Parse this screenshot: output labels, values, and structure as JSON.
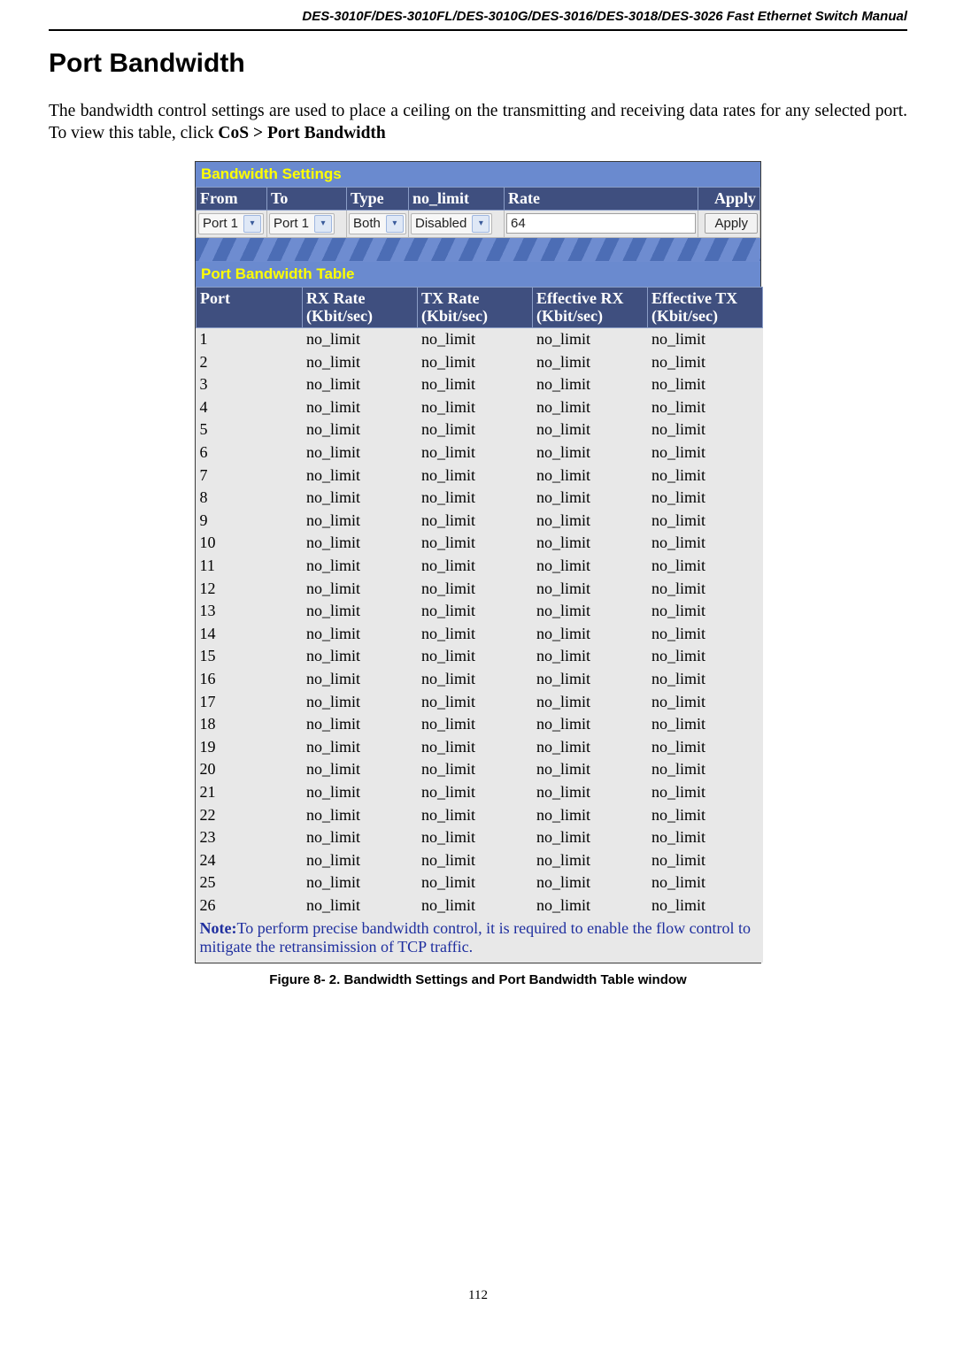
{
  "doc_header": "DES-3010F/DES-3010FL/DES-3010G/DES-3016/DES-3018/DES-3026 Fast Ethernet Switch Manual",
  "title": "Port Bandwidth",
  "intro_plain_before": "The bandwidth control settings are used to place a ceiling on the transmitting and receiving data rates for any selected port. To view this table, click ",
  "intro_bold": "CoS > Port Bandwidth",
  "settings": {
    "header": "Bandwidth Settings",
    "columns": {
      "from": "From",
      "to": "To",
      "type": "Type",
      "no_limit": "no_limit",
      "rate": "Rate",
      "apply_header": "Apply"
    },
    "values": {
      "from": "Port 1",
      "to": "Port 1",
      "type": "Both",
      "no_limit": "Disabled",
      "rate": "64",
      "apply_button": "Apply"
    }
  },
  "table": {
    "header": "Port Bandwidth Table",
    "columns": {
      "port": "Port",
      "rx": "RX Rate (Kbit/sec)",
      "tx": "TX Rate (Kbit/sec)",
      "erx": "Effective RX (Kbit/sec)",
      "etx": "Effective TX (Kbit/sec)"
    },
    "rows": [
      {
        "port": "1",
        "rx": "no_limit",
        "tx": "no_limit",
        "erx": "no_limit",
        "etx": "no_limit"
      },
      {
        "port": "2",
        "rx": "no_limit",
        "tx": "no_limit",
        "erx": "no_limit",
        "etx": "no_limit"
      },
      {
        "port": "3",
        "rx": "no_limit",
        "tx": "no_limit",
        "erx": "no_limit",
        "etx": "no_limit"
      },
      {
        "port": "4",
        "rx": "no_limit",
        "tx": "no_limit",
        "erx": "no_limit",
        "etx": "no_limit"
      },
      {
        "port": "5",
        "rx": "no_limit",
        "tx": "no_limit",
        "erx": "no_limit",
        "etx": "no_limit"
      },
      {
        "port": "6",
        "rx": "no_limit",
        "tx": "no_limit",
        "erx": "no_limit",
        "etx": "no_limit"
      },
      {
        "port": "7",
        "rx": "no_limit",
        "tx": "no_limit",
        "erx": "no_limit",
        "etx": "no_limit"
      },
      {
        "port": "8",
        "rx": "no_limit",
        "tx": "no_limit",
        "erx": "no_limit",
        "etx": "no_limit"
      },
      {
        "port": "9",
        "rx": "no_limit",
        "tx": "no_limit",
        "erx": "no_limit",
        "etx": "no_limit"
      },
      {
        "port": "10",
        "rx": "no_limit",
        "tx": "no_limit",
        "erx": "no_limit",
        "etx": "no_limit"
      },
      {
        "port": "11",
        "rx": "no_limit",
        "tx": "no_limit",
        "erx": "no_limit",
        "etx": "no_limit"
      },
      {
        "port": "12",
        "rx": "no_limit",
        "tx": "no_limit",
        "erx": "no_limit",
        "etx": "no_limit"
      },
      {
        "port": "13",
        "rx": "no_limit",
        "tx": "no_limit",
        "erx": "no_limit",
        "etx": "no_limit"
      },
      {
        "port": "14",
        "rx": "no_limit",
        "tx": "no_limit",
        "erx": "no_limit",
        "etx": "no_limit"
      },
      {
        "port": "15",
        "rx": "no_limit",
        "tx": "no_limit",
        "erx": "no_limit",
        "etx": "no_limit"
      },
      {
        "port": "16",
        "rx": "no_limit",
        "tx": "no_limit",
        "erx": "no_limit",
        "etx": "no_limit"
      },
      {
        "port": "17",
        "rx": "no_limit",
        "tx": "no_limit",
        "erx": "no_limit",
        "etx": "no_limit"
      },
      {
        "port": "18",
        "rx": "no_limit",
        "tx": "no_limit",
        "erx": "no_limit",
        "etx": "no_limit"
      },
      {
        "port": "19",
        "rx": "no_limit",
        "tx": "no_limit",
        "erx": "no_limit",
        "etx": "no_limit"
      },
      {
        "port": "20",
        "rx": "no_limit",
        "tx": "no_limit",
        "erx": "no_limit",
        "etx": "no_limit"
      },
      {
        "port": "21",
        "rx": "no_limit",
        "tx": "no_limit",
        "erx": "no_limit",
        "etx": "no_limit"
      },
      {
        "port": "22",
        "rx": "no_limit",
        "tx": "no_limit",
        "erx": "no_limit",
        "etx": "no_limit"
      },
      {
        "port": "23",
        "rx": "no_limit",
        "tx": "no_limit",
        "erx": "no_limit",
        "etx": "no_limit"
      },
      {
        "port": "24",
        "rx": "no_limit",
        "tx": "no_limit",
        "erx": "no_limit",
        "etx": "no_limit"
      },
      {
        "port": "25",
        "rx": "no_limit",
        "tx": "no_limit",
        "erx": "no_limit",
        "etx": "no_limit"
      },
      {
        "port": "26",
        "rx": "no_limit",
        "tx": "no_limit",
        "erx": "no_limit",
        "etx": "no_limit"
      }
    ],
    "note_label": "Note:",
    "note_text": "To perform precise bandwidth control, it is required to enable the flow control to mitigate the retransimission of TCP traffic."
  },
  "figure_caption": "Figure 8- 2. Bandwidth Settings and Port Bandwidth Table window",
  "page_number": "112"
}
